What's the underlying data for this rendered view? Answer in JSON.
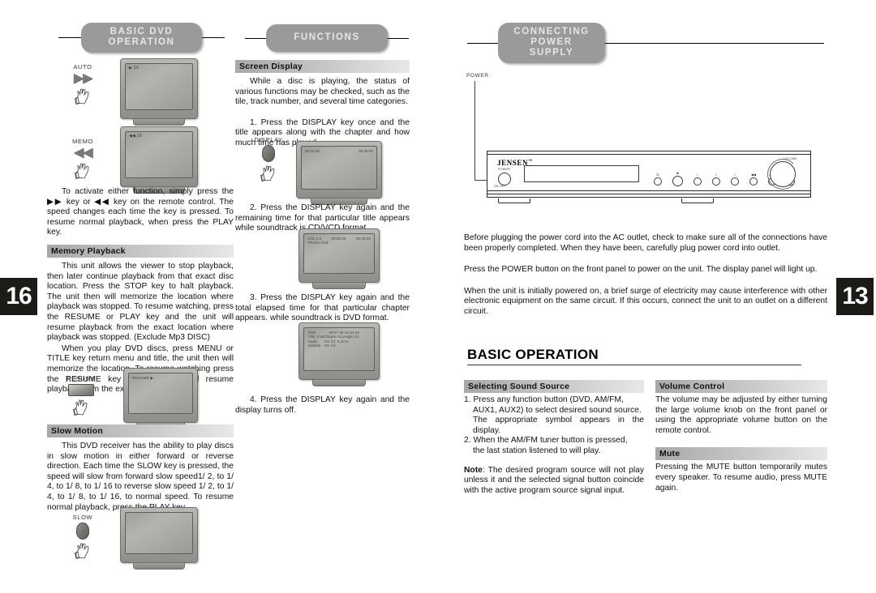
{
  "pages": {
    "left_number": "16",
    "right_number": "13"
  },
  "banners": {
    "basic_dvd_operation": "BASIC DVD\nOPERATION",
    "functions": "FUNCTIONS",
    "connecting_power_supply": "CONNECTING\nPOWER SUPPLY"
  },
  "left_page": {
    "column1": {
      "illustrations": [
        {
          "key_label": "AUTO",
          "key_glyph": "▶▶",
          "tv_osd": "▶ 2X"
        },
        {
          "key_label": "MEMO",
          "key_glyph": "◀◀",
          "tv_osd": "◀◀ 2X"
        }
      ],
      "intro_paragraph": "To activate either function, simply press  the ▶▶ key or ◀◀ key  on  the  remote  control.   The speed  changes  each  time the  key  is  pressed. To resume normal playback, when press the PLAY key.",
      "memory_playback": {
        "heading": "Memory Playback",
        "paragraph1": "This unit allows the viewer to stop playback, then later continue playback from that exact disc location. Press the STOP key to  halt  playback. The unit then will memorize the location  where playback  was  stopped.  To  resume  watching, press the RESUME or PLAY key and the unit will resume playback from the exact location where playback was stopped. (Exclude Mp3 DISC)",
        "paragraph2": "When you play  DVD discs,  press  MENU  or TITLE key return menu and title,  the  unit  then will memorize the location, To resume watching press the RESUME key and the unit  will resume playback from the exact location."
      },
      "resume_illustration": {
        "key_label": "RESUME",
        "tv_osd": "RESUME ▶"
      },
      "slow_motion": {
        "heading": "Slow Motion",
        "paragraph": "This DVD receiver has the  ability  to  play discs in slow motion in either forward or reverse direction. Each time the SLOW key  is  pressed, the speed will slow from forward slow speed1/ 2, to 1/ 4, to 1/ 8, to 1/ 16 to reverse slow speed 1/ 2, to 1/ 4,   to 1/ 8,  to 1/ 16,   to  normal  speed.   To resume  normal  playback,   press  the  PLAY key."
      },
      "slow_illustration": {
        "key_label": "SLOW",
        "tv_osd": ""
      }
    },
    "column2": {
      "screen_display": {
        "heading": "Screen Display",
        "paragraph": "While a disc is playing, the status of various functions may be checked, such as the tile, track number, and several time categories."
      },
      "step1": {
        "text": "1. Press the DISPLAY key once and the title appears along with the chapter  and how  much time has played.",
        "key_label": "DISPLAY",
        "tv_osd_left": "00:04:08",
        "tv_osd_right": "00:49:52"
      },
      "step2": {
        "text": "2.  Press  the  DISPLAY  key  again  and  the remaining time for that particular title appears while soundtrack  is CD/VCD format.",
        "tv_osd_line1_left": "VCD 2.0",
        "tv_osd_line1_mid": "00:00:26",
        "tv_osd_line1_right": "00:42:30",
        "tv_osd_line2": "TRACK 1/19"
      },
      "step3": {
        "text": "3. Press the DISPLAY key again and the total elapsed time for that particular chapter appears. while soundtrack is DVD format.",
        "tv_osd": [
          {
            "c1": "DVD",
            "c2": "",
            "c3": "00:07:35",
            "c4": "01:44:34"
          },
          {
            "c1": "Title",
            "c2": "1/18",
            "c3": "Chapter 5/1",
            "c4": "Angle  1/1"
          },
          {
            "c1": "Audio",
            "c2": "CH 1/1",
            "c3": "5.1CH",
            "c4": ""
          },
          {
            "c1": "Subtitle",
            "c2": "EN 1/3",
            "c3": "",
            "c4": ""
          }
        ]
      },
      "step4": {
        "text": "4. Press  the  DISPLAY  key  again  and  the display turns off."
      }
    }
  },
  "right_page": {
    "callout": {
      "power_label": "POWER"
    },
    "receiver": {
      "brand": "JENSEN",
      "brand_mark": "™",
      "power_label": "POWER",
      "power_sub": "ON  OFF",
      "volume_label": "VOLUME",
      "buttons": [
        "⏻",
        "■",
        "▪",
        "▪",
        "▪",
        "◀◀",
        "▶▶",
        "▪"
      ]
    },
    "paragraphs": [
      "Before  plugging  the power cord into the AC outlet, check to make sure all of the connections have been properly completed. When they have been, carefully plug power cord into outlet.",
      "Press the POWER button on the front panel to power on the unit. The display panel will light up.",
      "When the unit is initially powered on, a brief surge of electricity may cause interference with other electronic equipment on the same circuit. If this occurs, connect the unit  to an  outlet on a different circuit."
    ],
    "basic_operation_title": "BASIC OPERATION",
    "selecting_sound_source": {
      "heading": "Selecting Sound Source",
      "item1": "1. Press any function button (DVD, AM/FM,",
      "item1b": "AUX1, AUX2) to select desired sound source.",
      "item1c": "The appropriate symbol appears in the display.",
      "item2": "2. When the AM/FM tuner button is pressed,",
      "item2b": "the last station listened to will play.",
      "note_label": "Note",
      "note_text": ": The desired program source will not play unless it and the selected signal button coincide with the active program source signal input."
    },
    "volume_control": {
      "heading": "Volume Control",
      "paragraph": "The volume may be adjusted by either turning the  large  volume knob  on  the  front  panel or using  the  appropriate  volume  button  on  the remote control."
    },
    "mute": {
      "heading": "Mute",
      "paragraph": "Pressing the MUTE button temporarily mutes every speaker. To resume audio, press MUTE again."
    }
  }
}
